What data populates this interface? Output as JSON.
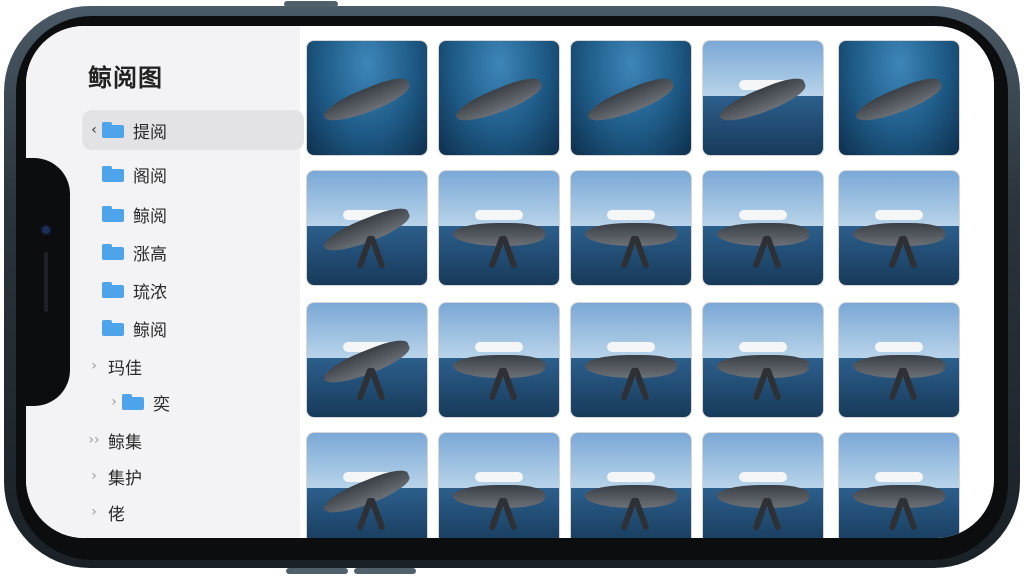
{
  "sidebar": {
    "title": "鲸阅图",
    "items": [
      {
        "label": "提阅",
        "chevron": "‹",
        "folder": true,
        "selected": true
      },
      {
        "label": "阁阅",
        "chevron": "",
        "folder": true,
        "selected": false
      },
      {
        "label": "鲸阅",
        "chevron": "",
        "folder": true,
        "selected": false
      },
      {
        "label": "涨高",
        "chevron": "",
        "folder": true,
        "selected": false
      },
      {
        "label": "琉浓",
        "chevron": "",
        "folder": true,
        "selected": false
      },
      {
        "label": "鲸阅",
        "chevron": "",
        "folder": true,
        "selected": false
      },
      {
        "label": "玛佳",
        "chevron": "›",
        "folder": false,
        "selected": false
      },
      {
        "label": "奕",
        "chevron": "›",
        "folder": true,
        "selected": false
      },
      {
        "label": "鲸集",
        "chevron": "››",
        "folder": false,
        "selected": false
      },
      {
        "label": "集护",
        "chevron": "›",
        "folder": false,
        "selected": false
      },
      {
        "label": "佬",
        "chevron": "›",
        "folder": false,
        "selected": false
      }
    ]
  },
  "gallery": {
    "rows": 4,
    "columns": 5,
    "subject": "humpback whale photos"
  },
  "colors": {
    "accent_folder": "#4ea4ea",
    "sidebar_bg": "#f3f3f5",
    "selected_bg": "#e3e3e6"
  }
}
